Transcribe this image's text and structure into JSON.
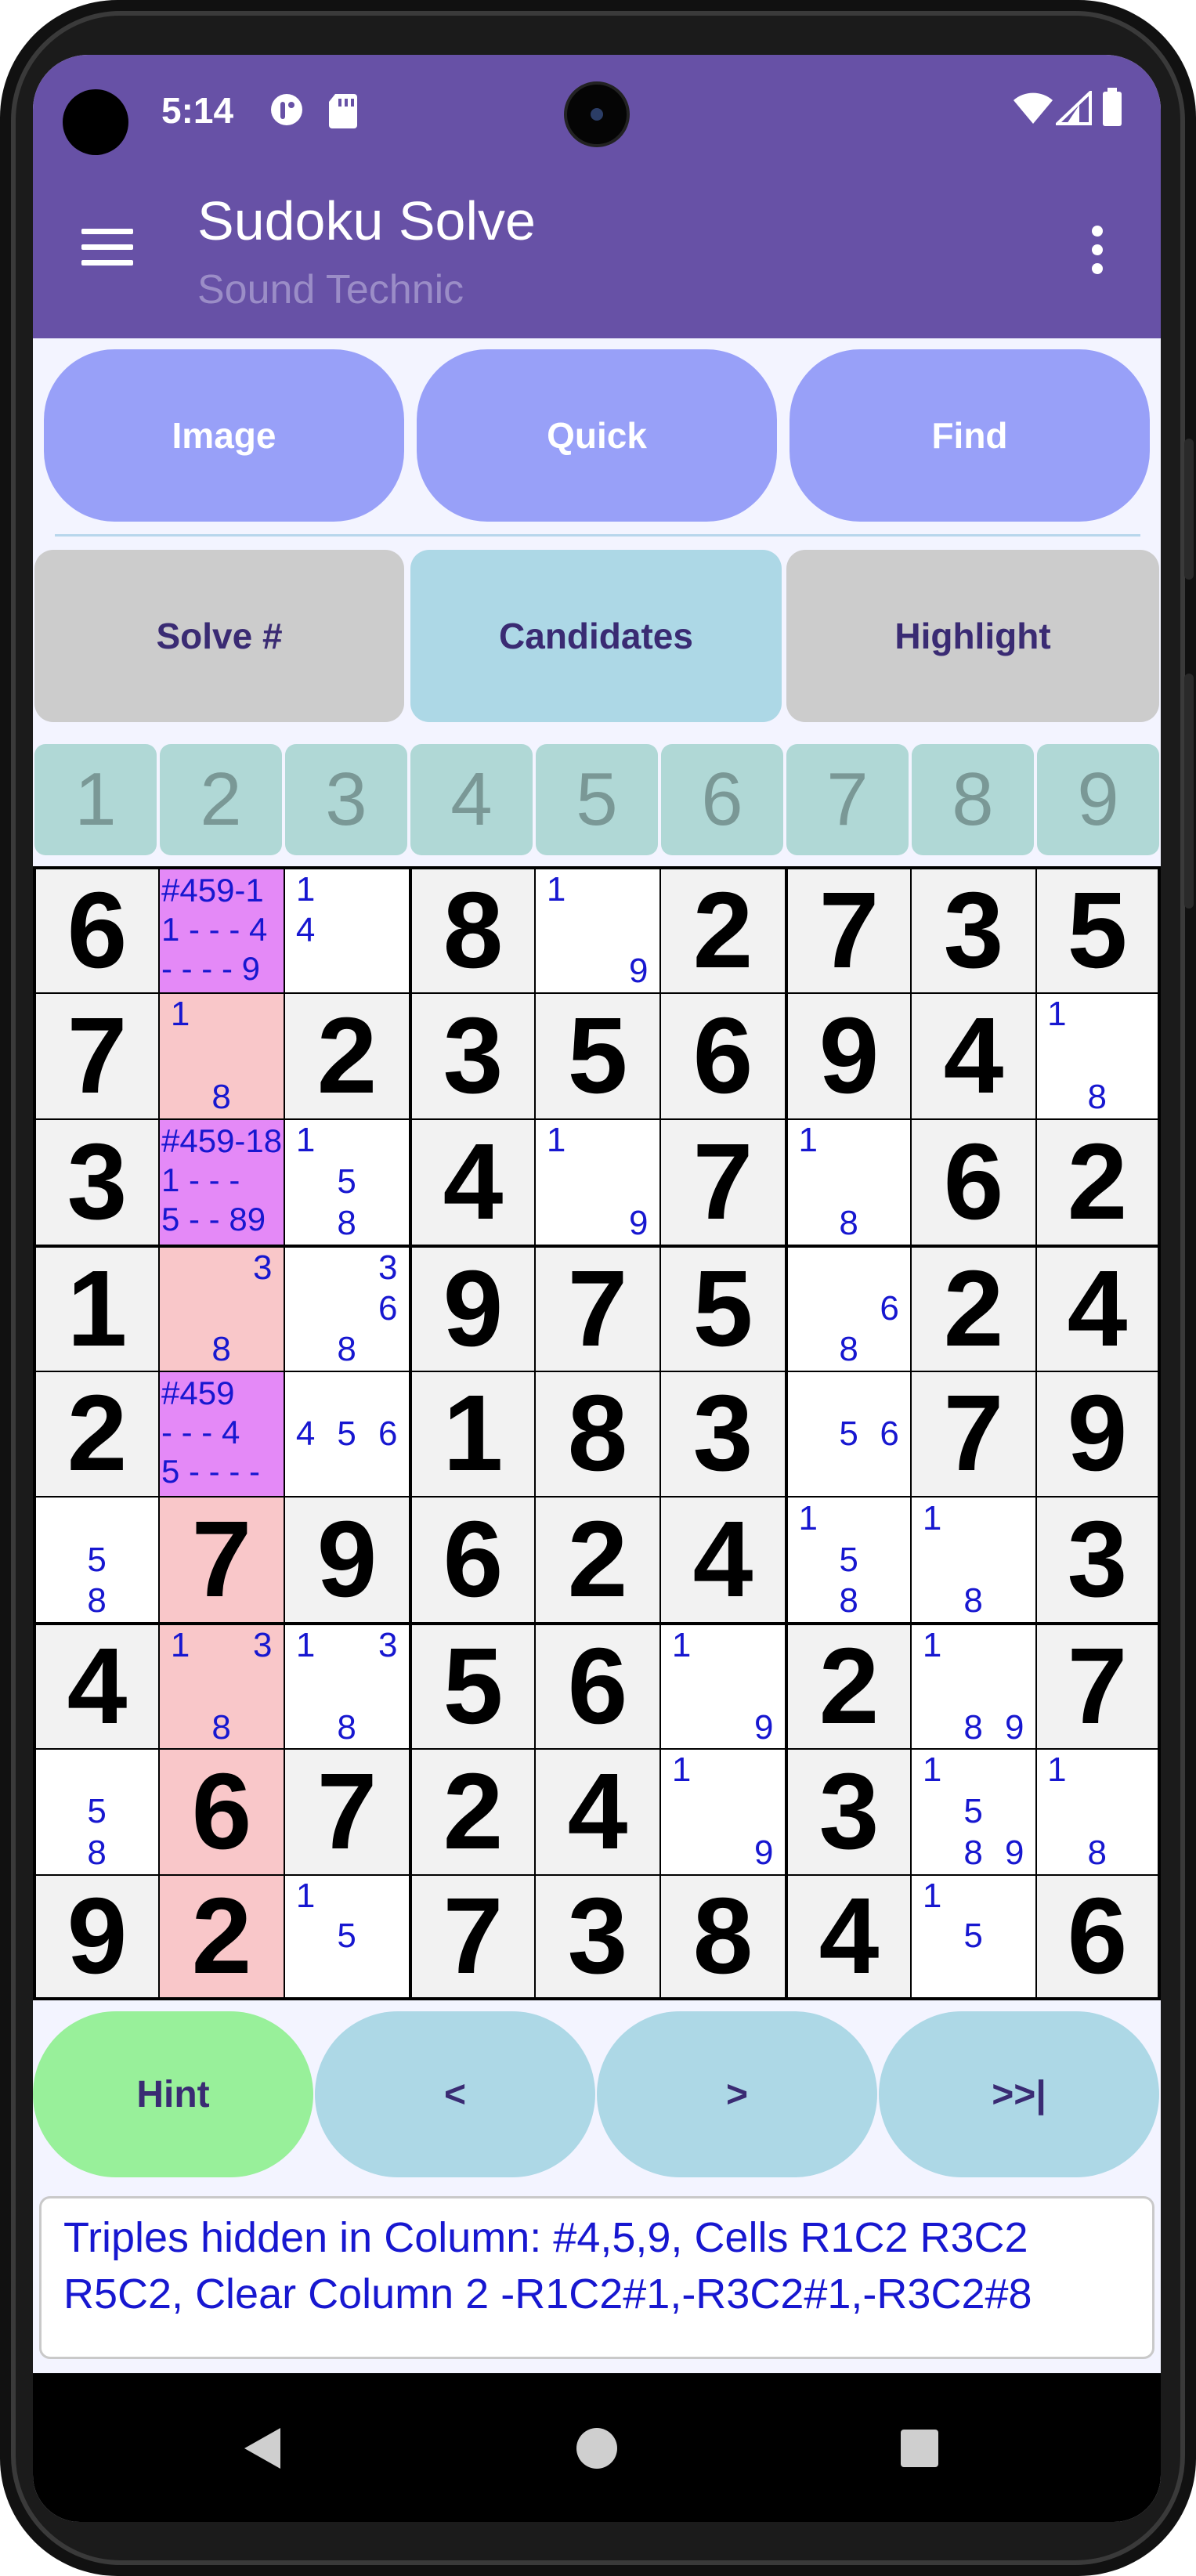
{
  "status_bar": {
    "time": "5:14",
    "left_icons": [
      "assistant-icon",
      "sd-card-icon"
    ],
    "right_icons": [
      "wifi-icon",
      "signal-icon",
      "battery-icon"
    ]
  },
  "toolbar": {
    "title": "Sudoku Solve",
    "subtitle": "Sound Technic",
    "menu_icon": "hamburger-menu-icon",
    "more_icon": "more-vert-icon"
  },
  "top_buttons": [
    {
      "label": "Image"
    },
    {
      "label": "Quick"
    },
    {
      "label": "Find"
    }
  ],
  "mode_buttons": [
    {
      "label": "Solve #",
      "selected": false
    },
    {
      "label": "Candidates",
      "selected": true
    },
    {
      "label": "Highlight",
      "selected": false
    }
  ],
  "number_palette": [
    "1",
    "2",
    "3",
    "4",
    "5",
    "6",
    "7",
    "8",
    "9"
  ],
  "grid": {
    "highlighted_column": 2,
    "cells": [
      [
        {
          "v": "6"
        },
        {
          "hidden": [
            "#459-1",
            "1 - - - 4",
            "- - - - 9"
          ]
        },
        {
          "cand": [
            "1",
            "4"
          ]
        },
        {
          "v": "8"
        },
        {
          "cand": [
            "1",
            "9"
          ]
        },
        {
          "v": "2"
        },
        {
          "v": "7"
        },
        {
          "v": "3"
        },
        {
          "v": "5"
        }
      ],
      [
        {
          "v": "7"
        },
        {
          "cand": [
            "1",
            "8"
          ]
        },
        {
          "v": "2"
        },
        {
          "v": "3"
        },
        {
          "v": "5"
        },
        {
          "v": "6"
        },
        {
          "v": "9"
        },
        {
          "v": "4"
        },
        {
          "cand": [
            "1",
            "8"
          ]
        }
      ],
      [
        {
          "v": "3"
        },
        {
          "hidden": [
            "#459-18",
            "1 - - -",
            "5 - - 89"
          ]
        },
        {
          "cand": [
            "1",
            "5",
            "8"
          ]
        },
        {
          "v": "4"
        },
        {
          "cand": [
            "1",
            "9"
          ]
        },
        {
          "v": "7"
        },
        {
          "cand": [
            "1",
            "8"
          ]
        },
        {
          "v": "6"
        },
        {
          "v": "2"
        }
      ],
      [
        {
          "v": "1"
        },
        {
          "cand": [
            "3",
            "8"
          ]
        },
        {
          "cand": [
            "3",
            "6",
            "8"
          ]
        },
        {
          "v": "9"
        },
        {
          "v": "7"
        },
        {
          "v": "5"
        },
        {
          "cand": [
            "6",
            "8"
          ]
        },
        {
          "v": "2"
        },
        {
          "v": "4"
        }
      ],
      [
        {
          "v": "2"
        },
        {
          "hidden": [
            "#459",
            "- - - 4",
            "5 - - - -"
          ]
        },
        {
          "cand": [
            "4",
            "5",
            "6"
          ]
        },
        {
          "v": "1"
        },
        {
          "v": "8"
        },
        {
          "v": "3"
        },
        {
          "cand": [
            "5",
            "6"
          ]
        },
        {
          "v": "7"
        },
        {
          "v": "9"
        }
      ],
      [
        {
          "cand": [
            "5",
            "8"
          ]
        },
        {
          "v": "7"
        },
        {
          "v": "9"
        },
        {
          "v": "6"
        },
        {
          "v": "2"
        },
        {
          "v": "4"
        },
        {
          "cand": [
            "1",
            "5",
            "8"
          ]
        },
        {
          "cand": [
            "1",
            "8"
          ]
        },
        {
          "v": "3"
        }
      ],
      [
        {
          "v": "4"
        },
        {
          "cand": [
            "1",
            "3",
            "8"
          ]
        },
        {
          "cand": [
            "1",
            "3",
            "8"
          ]
        },
        {
          "v": "5"
        },
        {
          "v": "6"
        },
        {
          "cand": [
            "1",
            "9"
          ]
        },
        {
          "v": "2"
        },
        {
          "cand": [
            "1",
            "8",
            "9"
          ]
        },
        {
          "v": "7"
        }
      ],
      [
        {
          "cand": [
            "5",
            "8"
          ]
        },
        {
          "v": "6"
        },
        {
          "v": "7"
        },
        {
          "v": "2"
        },
        {
          "v": "4"
        },
        {
          "cand": [
            "1",
            "9"
          ]
        },
        {
          "v": "3"
        },
        {
          "cand": [
            "1",
            "5",
            "8",
            "9"
          ]
        },
        {
          "cand": [
            "1",
            "8"
          ]
        }
      ],
      [
        {
          "v": "9"
        },
        {
          "v": "2"
        },
        {
          "cand": [
            "1",
            "5"
          ]
        },
        {
          "v": "7"
        },
        {
          "v": "3"
        },
        {
          "v": "8"
        },
        {
          "v": "4"
        },
        {
          "cand": [
            "1",
            "5"
          ]
        },
        {
          "v": "6"
        }
      ]
    ]
  },
  "bottom_buttons": [
    {
      "label": "Hint",
      "color": "#98f09a"
    },
    {
      "label": "<",
      "color": "#add8e6"
    },
    {
      "label": ">",
      "color": "#add8e6"
    },
    {
      "label": ">>|",
      "color": "#add8e6"
    }
  ],
  "message": "Triples hidden in Column: #4,5,9, Cells R1C2 R3C2 R5C2, Clear Column 2 -R1C2#1,-R3C2#1,-R3C2#8",
  "nav_bar": {
    "back": "back-icon",
    "home": "home-icon",
    "recents": "recents-icon"
  }
}
